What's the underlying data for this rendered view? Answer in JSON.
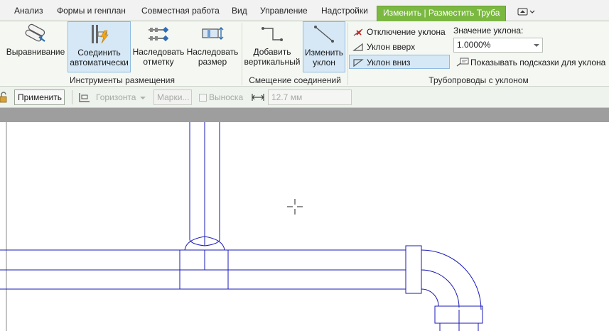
{
  "tabs": [
    {
      "label": "Анализ"
    },
    {
      "label": "Формы и генплан"
    },
    {
      "label": "Совместная работа"
    },
    {
      "label": "Вид"
    },
    {
      "label": "Управление"
    },
    {
      "label": "Надстройки"
    },
    {
      "label": "Изменить | Разместить Труба"
    }
  ],
  "ribbon": {
    "placement_tools": {
      "label": "Инструменты размещения",
      "buttons": [
        {
          "line1": "Выравнивание",
          "line2": "",
          "icon": "justify-pipes-icon"
        },
        {
          "line1": "Соединить",
          "line2": "автоматически",
          "icon": "autoconnect-icon",
          "selected": true
        },
        {
          "line1": "Наследовать",
          "line2": "отметку",
          "icon": "inherit-elevation-icon"
        },
        {
          "line1": "Наследовать",
          "line2": "размер",
          "icon": "inherit-size-icon"
        }
      ]
    },
    "offset_connections": {
      "label": "Смещение соединений",
      "buttons": [
        {
          "line1": "Добавить",
          "line2": "вертикальный",
          "icon": "add-vertical-icon"
        },
        {
          "line1": "Изменить",
          "line2": "уклон",
          "icon": "change-slope-icon",
          "selected": true
        }
      ]
    },
    "sloped_piping": {
      "label": "Трубопроводы с уклоном",
      "slope_off": "Отключение уклона",
      "slope_up": "Уклон вверх",
      "slope_down": "Уклон вниз",
      "slope_value_label": "Значение уклона:",
      "slope_value": "1.0000%",
      "show_tooltip": "Показывать подсказки для уклона"
    }
  },
  "options_bar": {
    "apply": "Применить",
    "horizontal": "Горизонта",
    "marks": "Марки...",
    "leader": "Выноска",
    "length": "12.7 мм"
  },
  "colors": {
    "active_tab": "#7bb841",
    "selection": "#d6e8f6",
    "pipe_lines": "#1a1ab8"
  }
}
